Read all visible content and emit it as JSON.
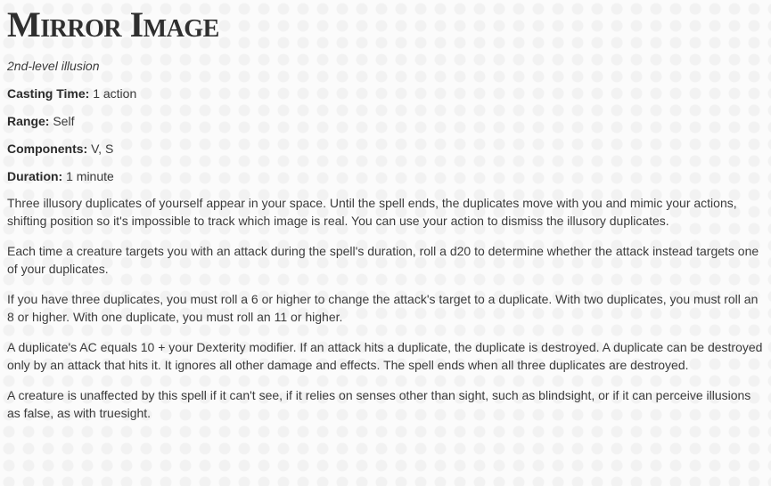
{
  "spell": {
    "title": "Mirror Image",
    "subtitle": "2nd-level illusion",
    "properties": [
      {
        "label": "Casting Time:",
        "value": "1 action"
      },
      {
        "label": "Range:",
        "value": "Self"
      },
      {
        "label": "Components:",
        "value": "V, S"
      },
      {
        "label": "Duration:",
        "value": "1 minute"
      }
    ],
    "paragraphs": [
      "Three illusory duplicates of yourself appear in your space. Until the spell ends, the duplicates move with you and mimic your actions, shifting position so it's impossible to track which image is real. You can use your action to dismiss the illusory duplicates.",
      "Each time a creature targets you with an attack during the spell's duration, roll a d20 to determine whether the attack instead targets one of your duplicates.",
      "If you have three duplicates, you must roll a 6 or higher to change the attack's target to a duplicate. With two duplicates, you must roll an 8 or higher. With one duplicate, you must roll an 11 or higher.",
      "A duplicate's AC equals 10 + your Dexterity modifier. If an attack hits a duplicate, the duplicate is destroyed. A duplicate can be destroyed only by an attack that hits it. It ignores all other damage and effects. The spell ends when all three duplicates are destroyed.",
      "A creature is unaffected by this spell if it can't see, if it relies on senses other than sight, such as blindsight, or if it can perceive illusions as false, as with truesight."
    ]
  }
}
